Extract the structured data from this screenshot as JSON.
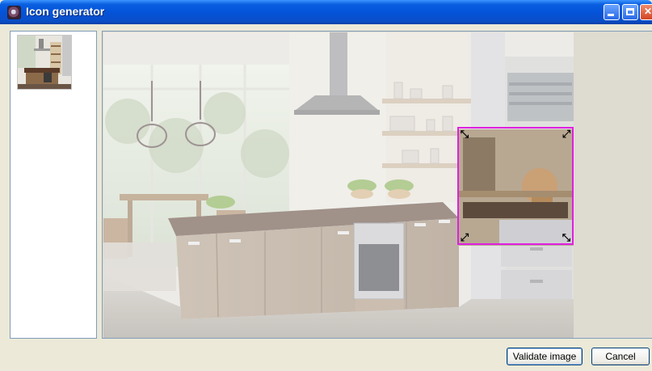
{
  "window": {
    "title": "Icon generator",
    "app_icon": "app-icon",
    "controls": [
      "minimize-icon",
      "maximize-icon",
      "close-icon"
    ]
  },
  "thumbnails": [
    {
      "image": "kitchen-thumbnail",
      "selected": true
    }
  ],
  "preview": {
    "image": "kitchen-photo",
    "crop_box_color": "#e020e0",
    "handles": [
      "resize-handle-top-left",
      "resize-handle-top-right",
      "resize-handle-bottom-left",
      "resize-handle-bottom-right"
    ]
  },
  "buttons": {
    "validate_label": "Validate image",
    "cancel_label": "Cancel"
  },
  "colors": {
    "titlebar": "#0453d9",
    "window_bg": "#ece9d8",
    "crop_box": "#e020e0"
  }
}
